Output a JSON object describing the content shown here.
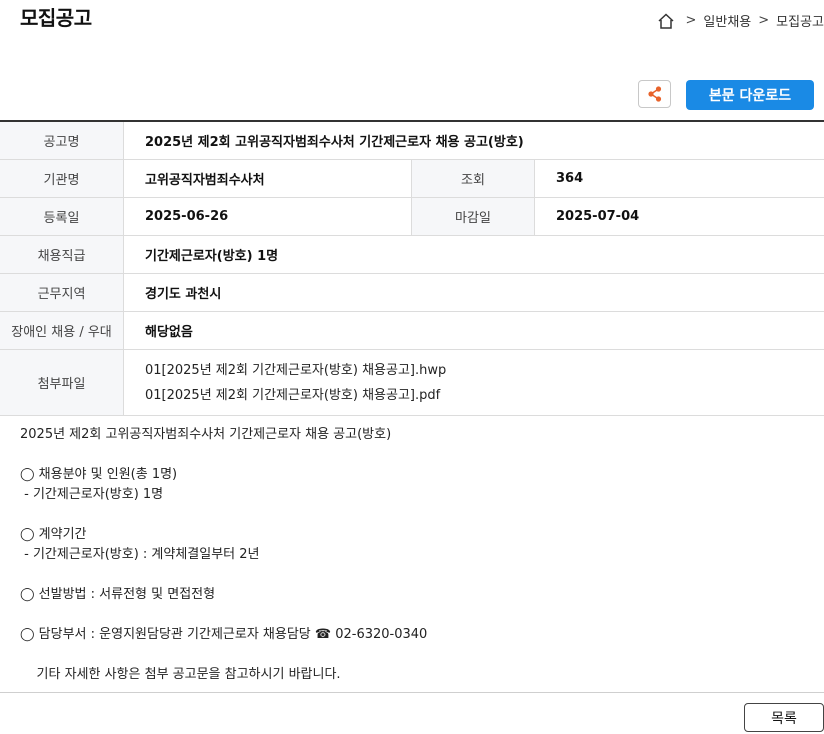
{
  "header": {
    "title": "모집공고",
    "breadcrumb": [
      ">",
      "일반채용",
      ">",
      "모집공고"
    ]
  },
  "toolbar": {
    "share_icon": "share-icon",
    "download_label": "본문 다운로드"
  },
  "colors": {
    "accent": "#1a8ae5",
    "share_icon": "#e8632b"
  },
  "info": {
    "title_label": "공고명",
    "title_value": "2025년 제2회 고위공직자범죄수사처 기간제근로자 채용 공고(방호)",
    "agency_label": "기관명",
    "agency_value": "고위공직자범죄수사처",
    "views_label": "조회",
    "views_value": "364",
    "reg_label": "등록일",
    "reg_value": "2025-06-26",
    "deadline_label": "마감일",
    "deadline_value": "2025-07-04",
    "rank_label": "채용직급",
    "rank_value": "기간제근로자(방호) 1명",
    "region_label": "근무지역",
    "region_value": "경기도 과천시",
    "disability_label": "장애인 채용 / 우대",
    "disability_value": "해당없음",
    "files_label": "첨부파일",
    "files": [
      "01[2025년 제2회 기간제근로자(방호) 채용공고].hwp",
      "01[2025년 제2회 기간제근로자(방호) 채용공고].pdf"
    ]
  },
  "body": {
    "lines": [
      "2025년 제2회 고위공직자범죄수사처 기간제근로자 채용 공고(방호)",
      "",
      "◯ 채용분야 및 인원(총 1명)",
      " - 기간제근로자(방호) 1명",
      "",
      "◯ 계약기간",
      " - 기간제근로자(방호) : 계약체결일부터 2년",
      "",
      "◯ 선발방법 : 서류전형 및 면접전형",
      "",
      "◯ 담당부서 : 운영지원담당관 기간제근로자 채용담당 ☎ 02-6320-0340",
      "",
      "    기타 자세한 사항은 첨부 공고문을 참고하시기 바랍니다."
    ]
  },
  "footer": {
    "list_label": "목록"
  }
}
